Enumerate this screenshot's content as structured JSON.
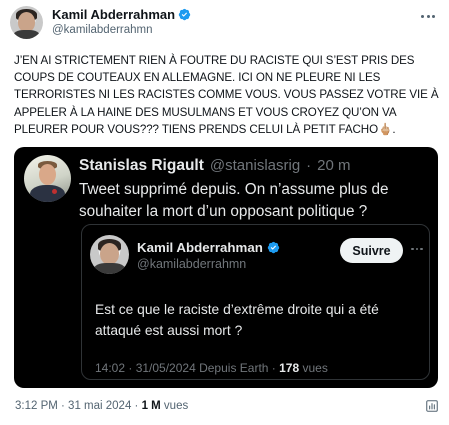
{
  "author": {
    "display_name": "Kamil Abderrahman",
    "handle": "@kamilabderrahmn"
  },
  "tweet": {
    "text": "J’EN AI STRICTEMENT RIEN À FOUTRE DU RACISTE QUI S’EST PRIS DES COUPS DE COUTEAUX EN ALLEMAGNE. ICI ON NE PLEURE NI LES TERRORISTES NI LES RACISTES COMME VOUS. VOUS PASSEZ VOTRE VIE À APPELER À LA HAINE DES MUSULMANS ET VOUS CROYEZ QU’ON VA PLEURER POUR VOUS??? TIENS PRENDS CELUI LÀ PETIT FACHO🖕🏼."
  },
  "quote": {
    "display_name": "Stanislas Rigault",
    "handle": "@stanislasrig",
    "separator": "·",
    "time": "20 m",
    "text": "Tweet supprimé depuis. On n’assume plus de souhaiter la mort d’un opposant politique ?",
    "inner": {
      "display_name": "Kamil Abderrahman",
      "handle": "@kamilabderrahmn",
      "follow_label": "Suivre",
      "text": "Est ce que le raciste d’extrême droite qui a été attaqué est aussi mort ?",
      "meta_prefix": "14:02 · 31/05/2024 Depuis Earth · ",
      "views_count": "178",
      "views_label": " vues"
    }
  },
  "footer": {
    "meta_prefix": "3:12 PM · 31 mai 2024 · ",
    "views_count": "1 M",
    "views_label": " vues"
  },
  "colors": {
    "verified_blue": "#1d9bf0",
    "quote_background": "#000000",
    "muted_text": "#536471"
  },
  "icons": [
    "verified-badge-icon",
    "more-options-icon",
    "view-stats-icon"
  ]
}
